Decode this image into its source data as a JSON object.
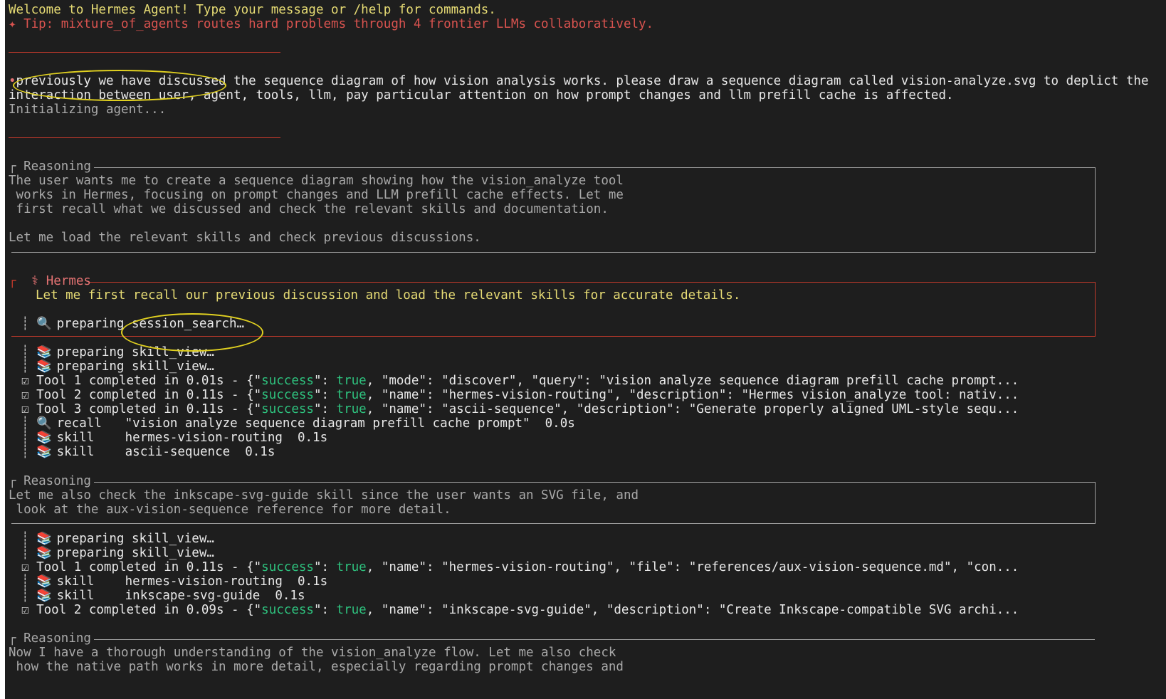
{
  "welcome": "Welcome to Hermes Agent! Type your message or /help for commands.",
  "tip": "✦ Tip: mixture_of_agents routes hard problems through 4 frontier LLMs collaboratively.",
  "user_message": {
    "line1_a": "previously we have discussed",
    "line1_b": " the sequence diagram of how vision analysis works. please draw a sequence diagram called vision-analyze.svg to deplict the",
    "line2": "interaction between user, agent, tools, llm, pay particular attention on how prompt changes and llm prefill cache is affected."
  },
  "initializing": "Initializing agent...",
  "reasoning1": {
    "label": "Reasoning",
    "lines": [
      "The user wants me to create a sequence diagram showing how the vision_analyze tool",
      " works in Hermes, focusing on prompt changes and LLM prefill cache effects. Let me",
      " first recall what we discussed and check the relevant skills and documentation.",
      "",
      "Let me load the relevant skills and check previous discussions."
    ]
  },
  "hermes": {
    "label": "Hermes",
    "message": "Let me first recall our previous discussion and load the relevant skills for accurate details.",
    "preparing_label": "preparing",
    "preparing_tool": "session_search…"
  },
  "block1": {
    "preparing": [
      "preparing skill_view…",
      "preparing skill_view…"
    ],
    "tools": [
      {
        "prefix": "Tool 1 completed in 0.01s - {\"",
        "rest": "\"mode\": \"discover\", \"query\": \"vision analyze sequence diagram prefill cache prompt..."
      },
      {
        "prefix": "Tool 2 completed in 0.11s - {\"",
        "rest": "\"name\": \"hermes-vision-routing\", \"description\": \"Hermes vision_analyze tool: nativ..."
      },
      {
        "prefix": "Tool 3 completed in 0.11s - {\"",
        "rest": "\"name\": \"ascii-sequence\", \"description\": \"Generate properly aligned UML-style sequ..."
      }
    ],
    "summary": [
      {
        "icon": "search-icon",
        "kind": "recall",
        "detail": "\"vision analyze sequence diagram prefill cache prompt\"  0.0s"
      },
      {
        "icon": "book-icon",
        "kind": "skill",
        "detail": "hermes-vision-routing  0.1s"
      },
      {
        "icon": "book-icon",
        "kind": "skill",
        "detail": "ascii-sequence  0.1s"
      }
    ]
  },
  "reasoning2": {
    "label": "Reasoning",
    "lines": [
      "Let me also check the inkscape-svg-guide skill since the user wants an SVG file, and",
      " look at the aux-vision-sequence reference for more detail."
    ]
  },
  "block2": {
    "preparing": [
      "preparing skill_view…",
      "preparing skill_view…"
    ],
    "tool1": {
      "prefix": "Tool 1 completed in 0.11s - {\"",
      "rest": "\"name\": \"hermes-vision-routing\", \"file\": \"references/aux-vision-sequence.md\", \"con..."
    },
    "skills": [
      {
        "kind": "skill",
        "detail": "hermes-vision-routing  0.1s"
      },
      {
        "kind": "skill",
        "detail": "inkscape-svg-guide  0.1s"
      }
    ],
    "tool2": {
      "prefix": "Tool 2 completed in 0.09s - {\"",
      "rest": "\"name\": \"inkscape-svg-guide\", \"description\": \"Create Inkscape-compatible SVG archi..."
    }
  },
  "reasoning3": {
    "label": "Reasoning",
    "lines": [
      "Now I have a thorough understanding of the vision_analyze flow. Let me also check",
      " how the native path works in more detail, especially regarding prompt changes and"
    ]
  },
  "json_tokens": {
    "success": "success",
    "true_val": "true",
    "after_true": ", "
  },
  "colors": {
    "background": "#1e1e1e",
    "accent_yellow": "#e6db74",
    "tip_red": "#d9534f",
    "json_green": "#2ec27e",
    "annotation_oval": "#e0d020"
  }
}
